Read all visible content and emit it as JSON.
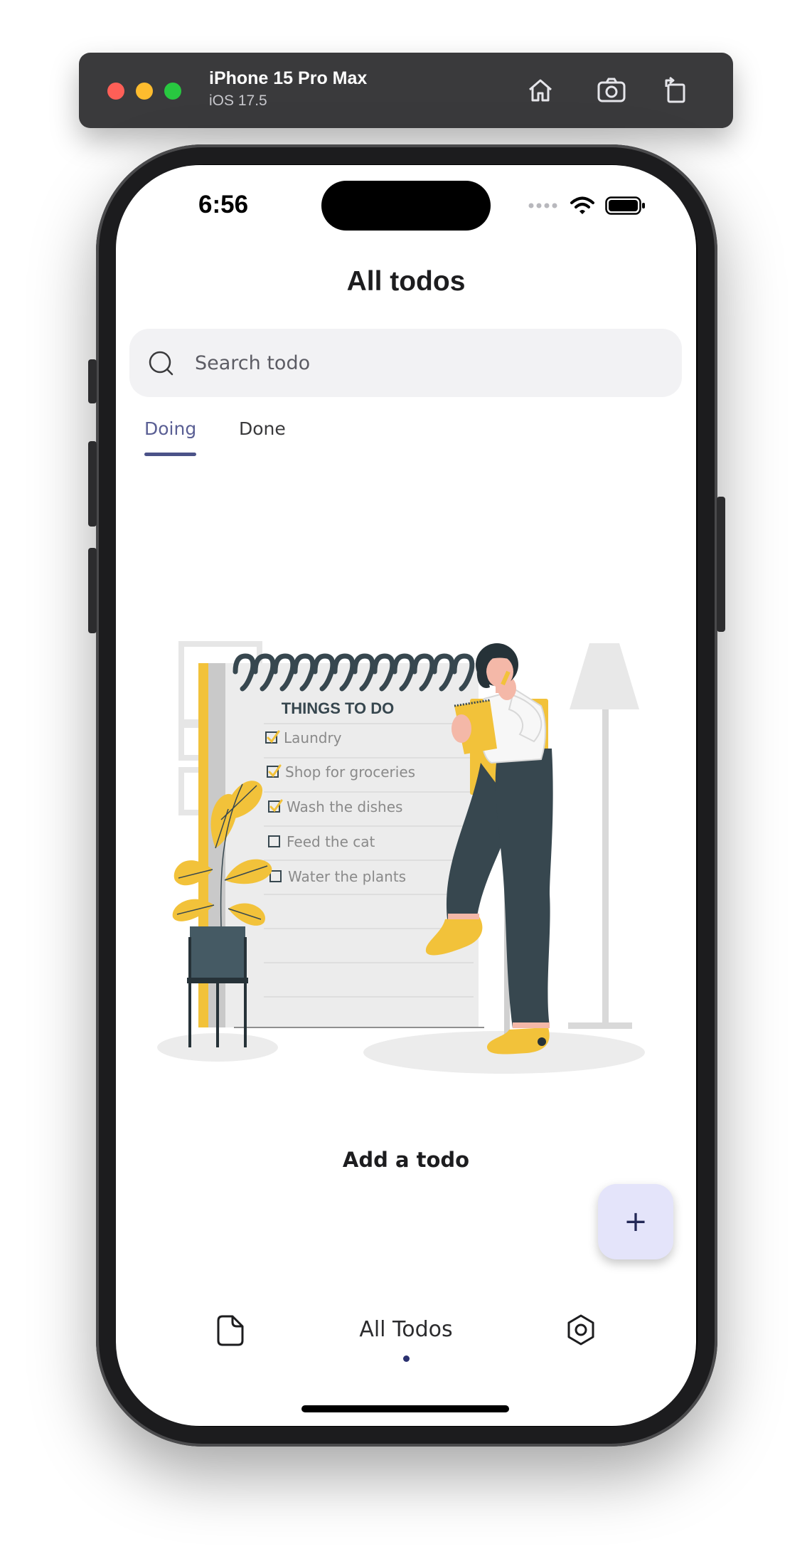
{
  "simulator": {
    "device_name": "iPhone 15 Pro Max",
    "os_version": "iOS 17.5",
    "icons": [
      "home-icon",
      "screenshot-icon",
      "rotate-icon"
    ]
  },
  "status_bar": {
    "time": "6:56",
    "icons": [
      "cellular-icon",
      "wifi-icon",
      "battery-icon"
    ]
  },
  "header": {
    "title": "All todos"
  },
  "search": {
    "placeholder": "Search todo",
    "value": ""
  },
  "tabs": [
    {
      "label": "Doing",
      "selected": true
    },
    {
      "label": "Done",
      "selected": false
    }
  ],
  "empty_state": {
    "heading": "THINGS TO DO",
    "checklist": [
      {
        "label": "Laundry",
        "checked": true
      },
      {
        "label": "Shop for groceries",
        "checked": true
      },
      {
        "label": "Wash the dishes",
        "checked": true
      },
      {
        "label": "Feed the cat",
        "checked": false
      },
      {
        "label": "Water the plants",
        "checked": false
      }
    ],
    "cta": "Add a todo"
  },
  "fab": {
    "icon": "plus-icon",
    "symbol": "+"
  },
  "bottom_nav": {
    "left_icon": "folder-icon",
    "center_label": "All Todos",
    "right_icon": "settings-icon"
  },
  "colors": {
    "accent": "#4b5288",
    "fab_bg": "#e4e4fa",
    "illustration_yellow": "#f2c23a",
    "illustration_dark": "#37474f"
  }
}
